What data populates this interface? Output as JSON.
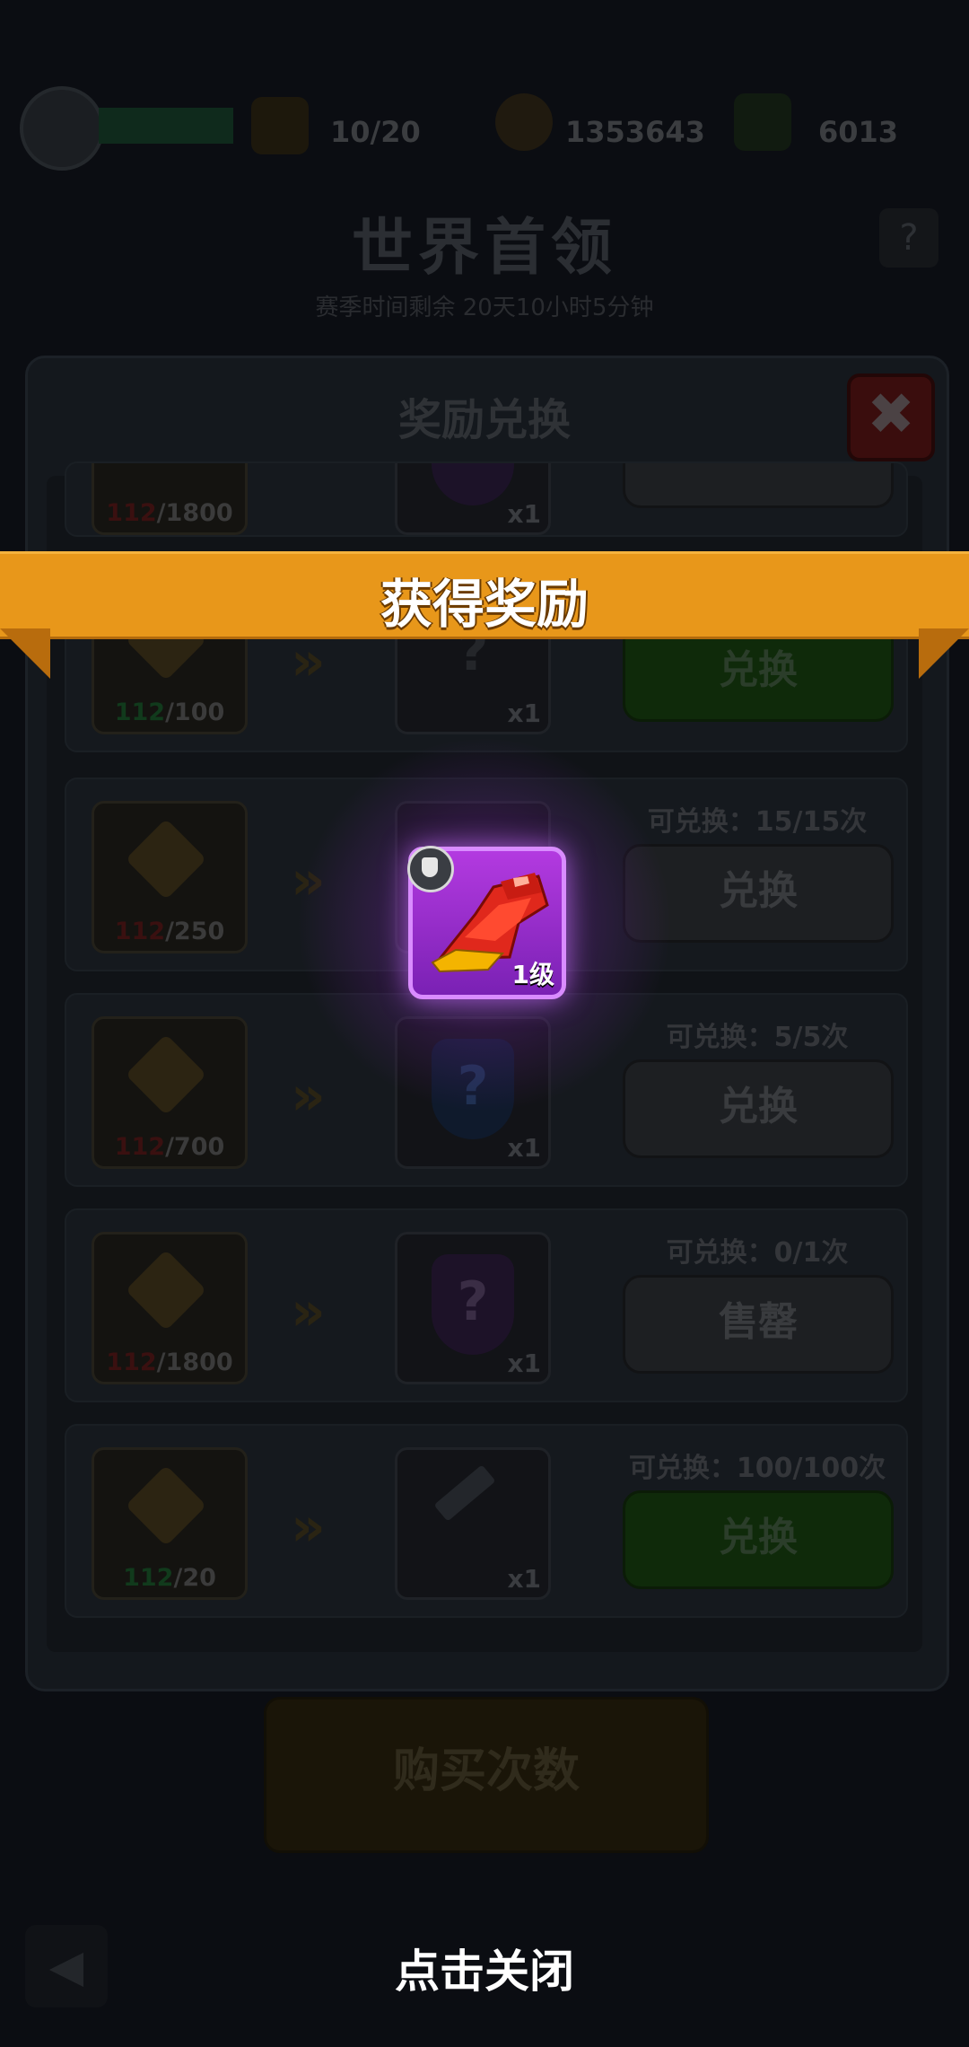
{
  "hud": {
    "level_label": "",
    "energy": "10/20",
    "coins": "1353643",
    "gems": "6013"
  },
  "page": {
    "title": "世界首领",
    "subtitle": "赛季时间剩余 20天10小时5分钟",
    "help": "?"
  },
  "panel": {
    "title": "奖励兑换",
    "close": "✖"
  },
  "rows": [
    {
      "have": "112",
      "need": "/1800",
      "have_color": "red",
      "reward": "shield-purple",
      "qty": "x1",
      "limit": "",
      "button": "",
      "button_style": "gray"
    },
    {
      "have": "112",
      "need": "/100",
      "have_color": "green",
      "reward": "unknown-dark",
      "qty": "x1",
      "limit": "",
      "button": "兑换",
      "button_style": "green"
    },
    {
      "have": "112",
      "need": "/250",
      "have_color": "red",
      "reward": "boots",
      "qty": "",
      "limit": "可兑换：15/15次",
      "button": "兑换",
      "button_style": "gray"
    },
    {
      "have": "112",
      "need": "/700",
      "have_color": "red",
      "reward": "shield-blue",
      "qty": "x1",
      "limit": "可兑换：5/5次",
      "button": "兑换",
      "button_style": "gray"
    },
    {
      "have": "112",
      "need": "/1800",
      "have_color": "red",
      "reward": "shield-purple",
      "qty": "x1",
      "limit": "可兑换：0/1次",
      "button": "售罄",
      "button_style": "gray"
    },
    {
      "have": "112",
      "need": "/20",
      "have_color": "green",
      "reward": "shard",
      "qty": "x1",
      "limit": "可兑换：100/100次",
      "button": "兑换",
      "button_style": "green"
    }
  ],
  "popup": {
    "banner": "获得奖励",
    "item_level": "1级",
    "item_icon": "red-boots-icon",
    "tap_to_close": "点击关闭"
  },
  "footer": {
    "buy_times": "购买次数",
    "back": "◀"
  },
  "colors": {
    "ribbon": "#e8971a",
    "item_frame": "#b33ae0"
  }
}
